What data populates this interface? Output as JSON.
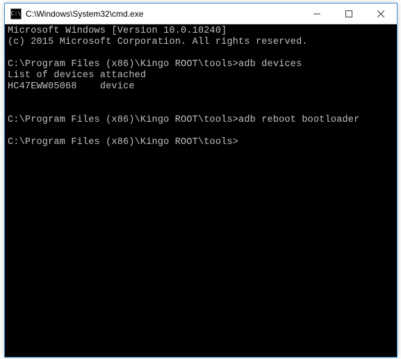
{
  "window": {
    "title": "C:\\Windows\\System32\\cmd.exe",
    "icon_label": "C:\\"
  },
  "console": {
    "lines": [
      "Microsoft Windows [Version 10.0.10240]",
      "(c) 2015 Microsoft Corporation. All rights reserved.",
      "",
      "C:\\Program Files (x86)\\Kingo ROOT\\tools>adb devices",
      "List of devices attached",
      "HC47EWW05068    device",
      "",
      "",
      "C:\\Program Files (x86)\\Kingo ROOT\\tools>adb reboot bootloader",
      "",
      "C:\\Program Files (x86)\\Kingo ROOT\\tools>"
    ]
  }
}
